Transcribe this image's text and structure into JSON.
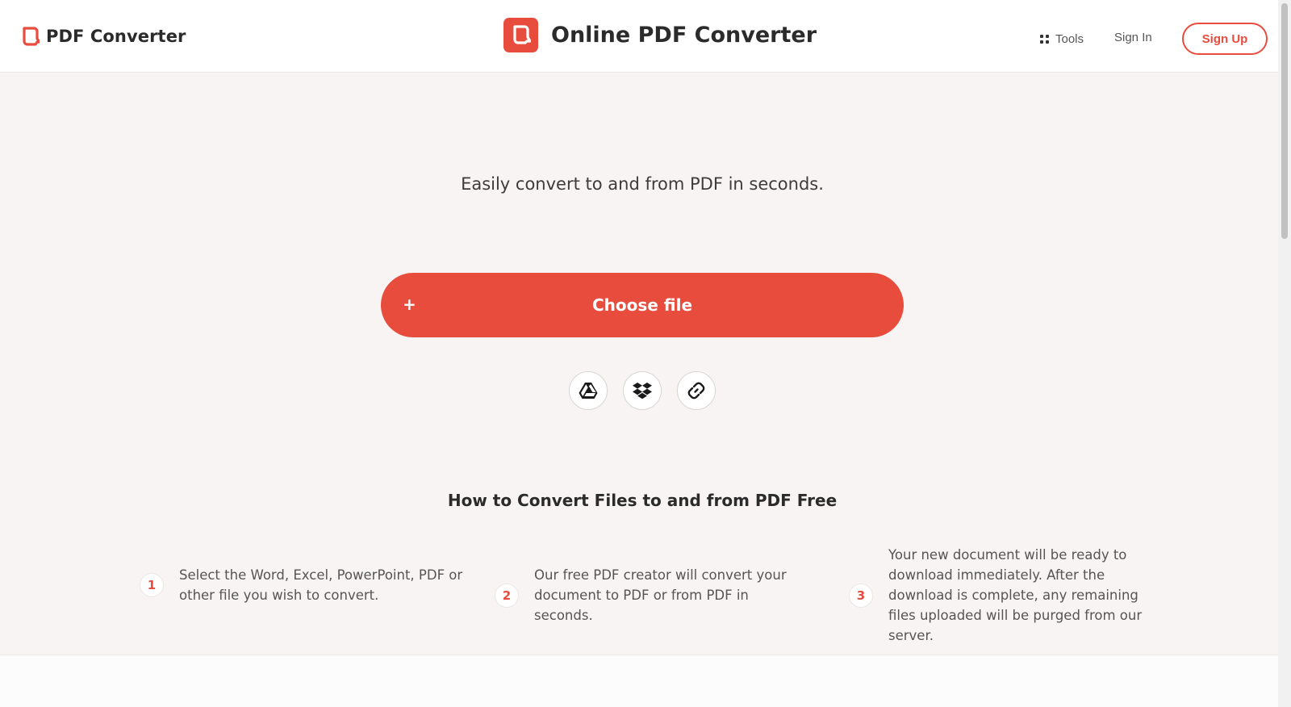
{
  "header": {
    "brand_name": "PDF Converter",
    "site_title": "Online PDF Converter",
    "nav": {
      "tools_label": "Tools",
      "signin_label": "Sign In",
      "signup_label": "Sign Up"
    }
  },
  "hero": {
    "tagline": "Easily convert to and from PDF in seconds.",
    "choose_plus": "+",
    "choose_label": "Choose file",
    "sources": [
      {
        "icon": "google-drive-icon"
      },
      {
        "icon": "dropbox-icon"
      },
      {
        "icon": "link-icon"
      }
    ]
  },
  "how_to": {
    "title": "How to Convert Files to and from PDF Free",
    "steps": [
      {
        "number": "1",
        "text": "Select the Word, Excel, PowerPoint, PDF or other file you wish to convert."
      },
      {
        "number": "2",
        "text": "Our free PDF creator will convert your document to PDF or from PDF in seconds."
      },
      {
        "number": "3",
        "text": "Your new document will be ready to download immediately. After the download is complete, any remaining files uploaded will be purged from our server."
      }
    ]
  },
  "colors": {
    "accent": "#e84c3d",
    "page_background": "#f8f4f3",
    "header_background": "#ffffff"
  }
}
